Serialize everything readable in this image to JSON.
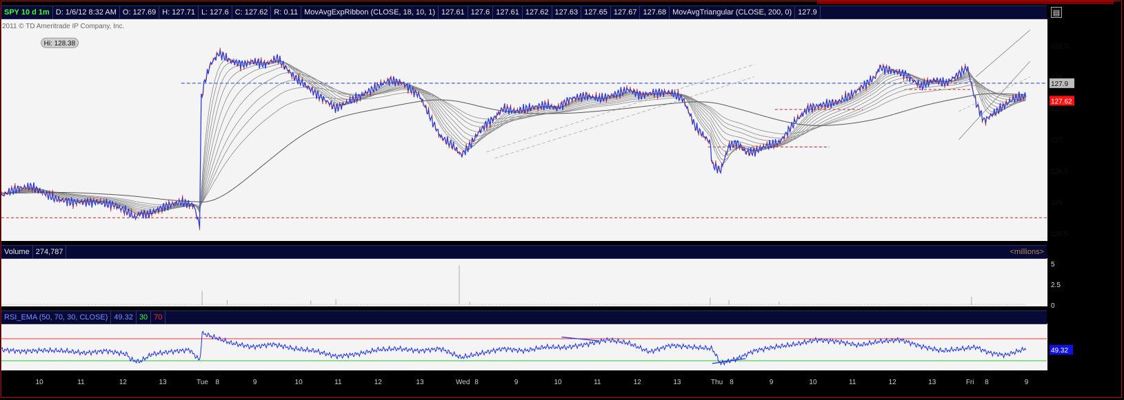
{
  "header": {
    "symbol": "SPY 10 d 1m",
    "date": "D: 1/6/12 8:32 AM",
    "open": "O: 127.69",
    "high": "H: 127.71",
    "low": "L: 127.6",
    "close": "C: 127.62",
    "range": "R: 0.11",
    "ribbon_label": "MovAvgExpRibbon (CLOSE, 18, 10, 1)",
    "ribbon_values": [
      "127.61",
      "127.6",
      "127.61",
      "127.62",
      "127.63",
      "127.65",
      "127.67",
      "127.68"
    ],
    "triangular_label": "MovAvgTriangular (CLOSE, 200, 0)",
    "triangular_value": "127.9"
  },
  "copyright": "2011 © TD Ameritrade IP Company, Inc.",
  "volume_header": {
    "label": "Volume",
    "value": "274,787",
    "units": "<millions>"
  },
  "rsi_header": {
    "label": "RSI_EMA (50, 70, 30, CLOSE)",
    "value": "49.32",
    "oversold": "30",
    "overbought": "70"
  },
  "chart_data": [
    {
      "type": "line",
      "title": "SPY 10 d 1m",
      "ylim": [
        125.4,
        128.9
      ],
      "yticks": [
        125.5,
        126,
        126.5,
        127,
        127.5,
        128,
        128.5
      ],
      "ytick_labels": [
        "125.5",
        "126",
        "126.5",
        "127",
        "127.5",
        "128",
        "128.5"
      ],
      "price_labels": [
        {
          "text": "127.9",
          "value": 127.9,
          "color": "#bdbdbd"
        },
        {
          "text": "127.62",
          "value": 127.62,
          "color": "#ff1010"
        }
      ],
      "annotations": [
        {
          "text": "Hi: 128.38",
          "x": 0.95,
          "y": 128.38
        }
      ],
      "x_domain": [
        0,
        25
      ],
      "series": [
        {
          "color": "#2a3cd8",
          "x": [
            0,
            0.3,
            0.7,
            1,
            1.3,
            1.7,
            2,
            2.3,
            2.7,
            3,
            3.2,
            3.3,
            3.5,
            3.8,
            4,
            4.3,
            4.6,
            4.75,
            4.77,
            4.85,
            5,
            5.2,
            5.5,
            5.8,
            6,
            6.3,
            6.6,
            7,
            7.3,
            7.6,
            8,
            8.3,
            8.6,
            9,
            9.3,
            9.6,
            10,
            10.3,
            10.5,
            10.8,
            11,
            11.2,
            11.4,
            11.6,
            11.8,
            12,
            12.3,
            12.6,
            13,
            13.3,
            13.6,
            14,
            14.3,
            14.6,
            15,
            15.3,
            15.6,
            16,
            16.3,
            16.6,
            16.95,
            17,
            17.2,
            17.4,
            17.6,
            17.8,
            18,
            18.3,
            18.6,
            19,
            19.3,
            19.6,
            20,
            20.3,
            20.6,
            20.9,
            21,
            21.3,
            21.6,
            22,
            22.3,
            22.6,
            22.9,
            23.1,
            23.3,
            23.5,
            23.7,
            24,
            24.2,
            24.5
          ],
          "values": [
            126.1,
            126.2,
            126.25,
            126.15,
            126.05,
            126.0,
            126.0,
            126.0,
            125.95,
            125.85,
            125.75,
            125.82,
            125.8,
            125.9,
            125.95,
            126.0,
            125.95,
            125.6,
            127.6,
            127.9,
            128.2,
            128.38,
            128.25,
            128.2,
            128.25,
            128.2,
            128.3,
            128.0,
            127.85,
            127.7,
            127.5,
            127.6,
            127.7,
            127.85,
            127.95,
            127.9,
            127.7,
            127.3,
            127.05,
            126.9,
            126.75,
            126.9,
            127.1,
            127.25,
            127.35,
            127.5,
            127.45,
            127.5,
            127.55,
            127.5,
            127.65,
            127.7,
            127.65,
            127.7,
            127.8,
            127.7,
            127.75,
            127.75,
            127.65,
            127.2,
            126.95,
            126.6,
            126.5,
            126.9,
            126.95,
            126.8,
            126.8,
            126.9,
            126.95,
            127.3,
            127.5,
            127.55,
            127.6,
            127.7,
            127.85,
            128.0,
            128.15,
            128.1,
            128.05,
            127.85,
            127.95,
            127.9,
            128.05,
            128.15,
            127.6,
            127.3,
            127.4,
            127.55,
            127.65,
            127.7
          ]
        }
      ]
    },
    {
      "type": "bar",
      "title": "Volume",
      "ylim": [
        0,
        5.5
      ],
      "yticks": [
        0,
        2.5,
        5
      ],
      "ytick_labels": [
        "0",
        "2.5",
        "5"
      ],
      "spikes": [
        {
          "x": 4.8,
          "value": 1.7
        },
        {
          "x": 5.4,
          "value": 0.6
        },
        {
          "x": 7.4,
          "value": 0.55
        },
        {
          "x": 8.0,
          "value": 0.7
        },
        {
          "x": 10.95,
          "value": 4.8
        },
        {
          "x": 11.2,
          "value": 0.4
        },
        {
          "x": 16.95,
          "value": 0.9
        },
        {
          "x": 17.4,
          "value": 0.6
        },
        {
          "x": 18.6,
          "value": 0.4
        },
        {
          "x": 23.2,
          "value": 1.0
        }
      ]
    },
    {
      "type": "line",
      "title": "RSI_EMA (50, 70, 30, CLOSE)",
      "ylim": [
        15,
        95
      ],
      "levels": [
        {
          "value": 70,
          "color": "#ff3030"
        },
        {
          "value": 30,
          "color": "#22cc22"
        }
      ],
      "value_label": "49.32",
      "x": [
        0,
        0.5,
        1,
        1.5,
        2,
        2.5,
        3,
        3.1,
        3.3,
        3.6,
        4,
        4.5,
        4.75,
        4.8,
        5,
        5.5,
        6,
        6.5,
        7,
        7.5,
        8,
        8.5,
        9,
        9.5,
        10,
        10.5,
        11,
        11.5,
        12,
        12.5,
        13,
        13.5,
        14,
        14.5,
        15,
        15.5,
        16,
        16.5,
        17,
        17.2,
        17.6,
        18,
        18.5,
        19,
        19.5,
        20,
        20.5,
        21,
        21.5,
        22,
        22.5,
        23,
        23.3,
        23.6,
        24,
        24.5
      ],
      "values": [
        50,
        47,
        49,
        48,
        44,
        48,
        42,
        32,
        28,
        42,
        46,
        50,
        30,
        80,
        75,
        62,
        55,
        60,
        52,
        48,
        38,
        42,
        50,
        52,
        48,
        52,
        36,
        44,
        52,
        48,
        55,
        54,
        60,
        68,
        62,
        46,
        58,
        55,
        52,
        25,
        34,
        48,
        55,
        60,
        68,
        65,
        58,
        65,
        68,
        56,
        48,
        52,
        55,
        45,
        40,
        52
      ],
      "lower_trendline": {
        "x": [
          17.0,
          17.8
        ],
        "values": [
          25,
          34
        ]
      },
      "upper_trendline": {
        "x": [
          13.4,
          14.3
        ],
        "values": [
          73,
          66
        ]
      }
    }
  ],
  "x_axis": {
    "labels": [
      {
        "x": 0.9,
        "text": "10"
      },
      {
        "x": 1.9,
        "text": "11"
      },
      {
        "x": 2.9,
        "text": "12"
      },
      {
        "x": 3.85,
        "text": "13"
      },
      {
        "x": 4.75,
        "text": "Tue"
      },
      {
        "x": 5.2,
        "text": "8"
      },
      {
        "x": 6.1,
        "text": "9"
      },
      {
        "x": 7.1,
        "text": "10"
      },
      {
        "x": 8.05,
        "text": "11"
      },
      {
        "x": 9.0,
        "text": "12"
      },
      {
        "x": 10.0,
        "text": "13"
      },
      {
        "x": 10.95,
        "text": "Wed"
      },
      {
        "x": 11.4,
        "text": "8"
      },
      {
        "x": 12.35,
        "text": "9"
      },
      {
        "x": 13.3,
        "text": "10"
      },
      {
        "x": 14.25,
        "text": "11"
      },
      {
        "x": 15.2,
        "text": "12"
      },
      {
        "x": 16.15,
        "text": "13"
      },
      {
        "x": 17.05,
        "text": "Thu"
      },
      {
        "x": 17.5,
        "text": "8"
      },
      {
        "x": 18.45,
        "text": "9"
      },
      {
        "x": 19.4,
        "text": "10"
      },
      {
        "x": 20.35,
        "text": "11"
      },
      {
        "x": 21.3,
        "text": "12"
      },
      {
        "x": 22.25,
        "text": "13"
      },
      {
        "x": 23.15,
        "text": "Fri"
      },
      {
        "x": 23.6,
        "text": "8"
      },
      {
        "x": 24.55,
        "text": "9"
      }
    ]
  },
  "colors": {
    "panel_bg": "#f4f4f4",
    "price": "#2a3cd8",
    "ribbon": "#8a8a8a",
    "support_line": "#cc2020",
    "triangular_line": "#1e3cc8",
    "volume": "#c8c8c8",
    "rsi": "#1e2ee0"
  }
}
